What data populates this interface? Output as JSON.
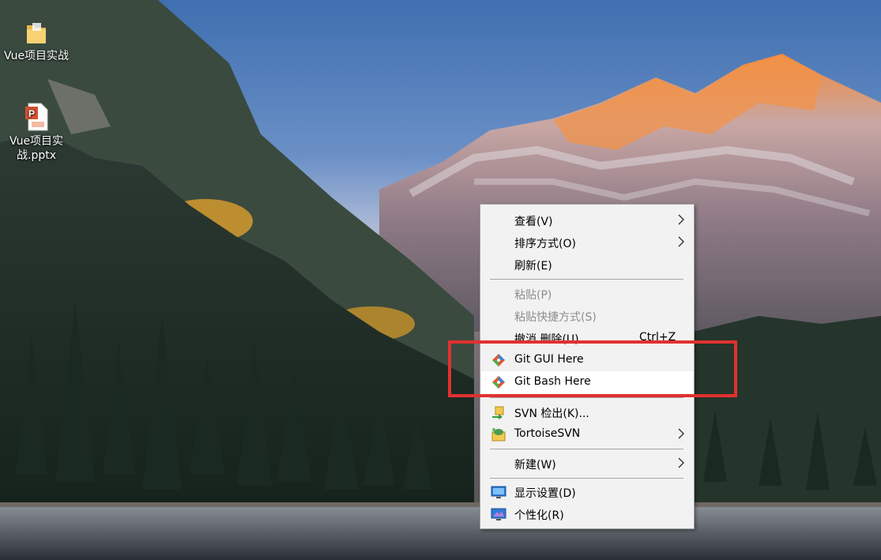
{
  "desktop": {
    "icons": [
      {
        "label": "Vue项目实战",
        "icon": "folder-icon"
      },
      {
        "label": "Vue项目实战.pptx",
        "icon": "powerpoint-file-icon"
      }
    ]
  },
  "context_menu": {
    "items": [
      {
        "label": "查看(V)",
        "submenu": true
      },
      {
        "label": "排序方式(O)",
        "submenu": true
      },
      {
        "label": "刷新(E)"
      },
      {
        "label": "粘贴(P)",
        "disabled": true
      },
      {
        "label": "粘贴快捷方式(S)",
        "disabled": true
      },
      {
        "label": "撤消 删除(U)",
        "shortcut": "Ctrl+Z"
      },
      {
        "label": "Git GUI Here",
        "icon": "git-icon"
      },
      {
        "label": "Git Bash Here",
        "icon": "git-icon",
        "hovered": true
      },
      {
        "label": "SVN 检出(K)...",
        "icon": "svn-checkout-icon"
      },
      {
        "label": "TortoiseSVN",
        "icon": "tortoisesvn-icon",
        "submenu": true
      },
      {
        "label": "新建(W)",
        "submenu": true
      },
      {
        "label": "显示设置(D)",
        "icon": "display-settings-icon"
      },
      {
        "label": "个性化(R)",
        "icon": "personalize-icon"
      }
    ]
  },
  "colors": {
    "highlight_box": "#e2302f",
    "menu_background": "#f2f2f2",
    "git_orange": "#e4572e",
    "git_blue": "#3b82d6"
  }
}
